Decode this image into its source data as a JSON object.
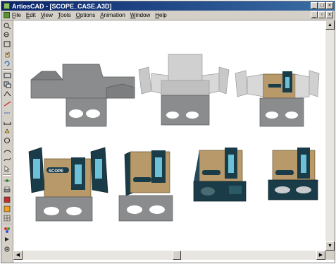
{
  "window": {
    "title": "ArtiosCAD - [SCOPE_CASE.A3D]"
  },
  "menu": [
    "File",
    "Edit",
    "View",
    "Tools",
    "Options",
    "Animation",
    "Window",
    "Help"
  ],
  "title_buttons": [
    "_",
    "□",
    "×"
  ],
  "doc_buttons": [
    "_",
    "▫",
    "×"
  ],
  "product": {
    "brand": "SCOPE"
  },
  "colors": {
    "titlebar": "#0a246a",
    "panel_gray": "#8a8c8e",
    "kraft": "#b89a6a",
    "teal": "#1a3c48"
  },
  "toolbar_icons": [
    "zoom-in-icon",
    "zoom-out-icon",
    "zoom-window-icon",
    "pan-hand-icon",
    "rotate-icon",
    "view-icon",
    "layer-icon",
    "fold-icon",
    "cut-icon",
    "crease-icon",
    "measure-icon",
    "dimension-icon",
    "circle-icon",
    "arc-icon",
    "spline-icon",
    "select-icon",
    "snap-icon",
    "print-icon",
    "export-icon",
    "render-icon",
    "grid-icon",
    "palette-icon",
    "animate-icon",
    "settings-icon"
  ]
}
